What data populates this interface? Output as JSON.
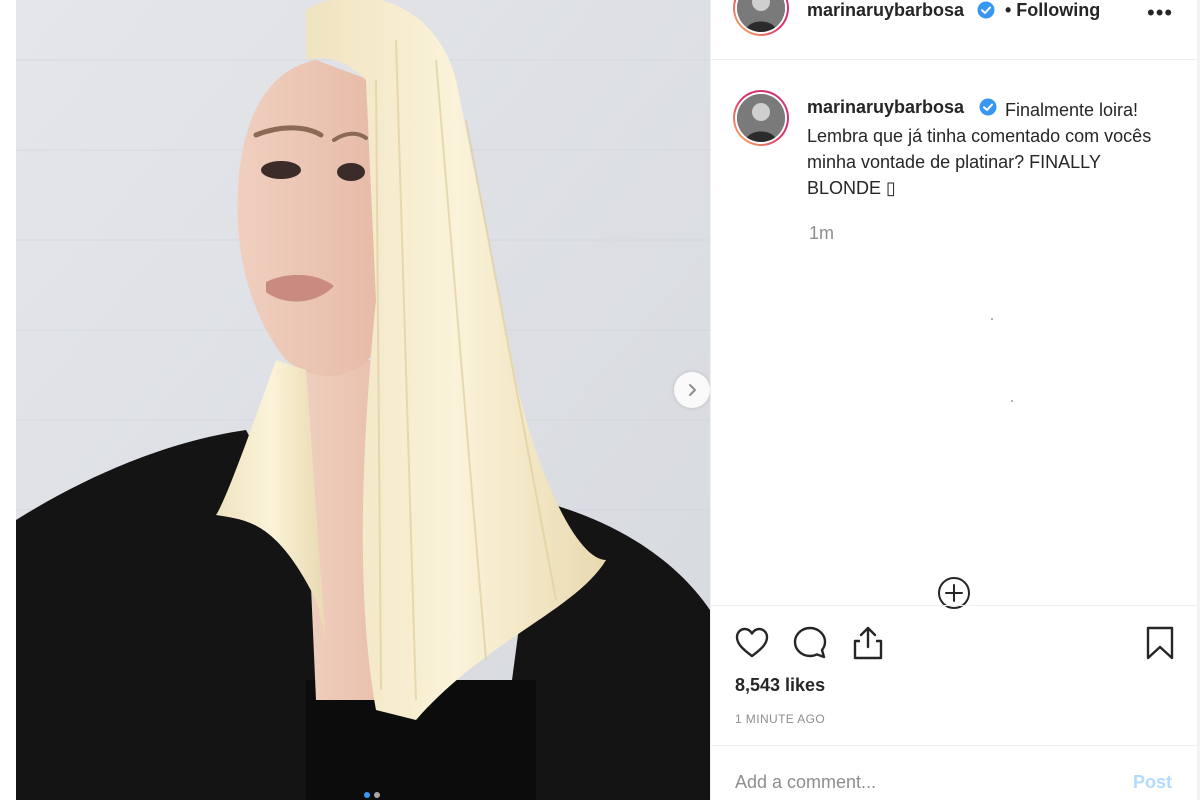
{
  "post": {
    "username": "marinaruybarbosa",
    "following_label": "• Following",
    "more_icon": "ellipsis-icon",
    "carousel_dots": 2
  },
  "caption": {
    "username": "marinaruybarbosa",
    "text": "Finalmente loira! Lembra que já tinha comentado com vocês minha vontade de platinar? FINALLY BLONDE ",
    "emoji_placeholder": "▯",
    "time": "1m"
  },
  "actions": {
    "like_icon": "heart-icon",
    "comment_icon": "comment-bubble-icon",
    "share_icon": "share-icon",
    "save_icon": "bookmark-icon"
  },
  "stats": {
    "likes": "8,543 likes",
    "posted": "1 MINUTE AGO"
  },
  "comment": {
    "placeholder": "Add a comment...",
    "post_label": "Post"
  },
  "colors": {
    "verified": "#3897f0",
    "post_button_disabled": "#b3dbff",
    "muted_text": "#8e8e8e"
  }
}
